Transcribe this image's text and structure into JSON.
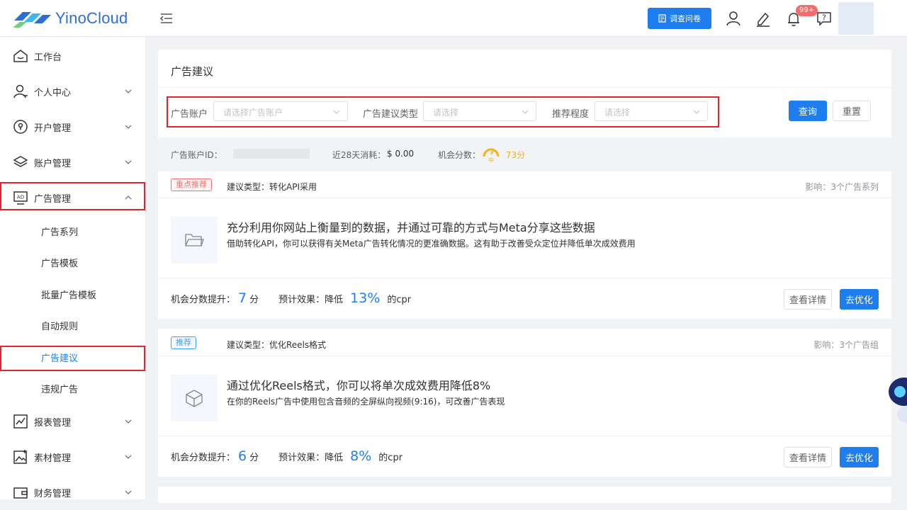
{
  "header": {
    "brand": "YinoCloud",
    "survey_label": "调查问卷",
    "notification_count": "99+"
  },
  "sidebar": {
    "items": [
      {
        "label": "工作台"
      },
      {
        "label": "个人中心"
      },
      {
        "label": "开户管理"
      },
      {
        "label": "账户管理"
      },
      {
        "label": "广告管理"
      },
      {
        "label": "报表管理"
      },
      {
        "label": "素材管理"
      },
      {
        "label": "财务管理"
      }
    ],
    "sub_items": [
      {
        "label": "广告系列"
      },
      {
        "label": "广告模板"
      },
      {
        "label": "批量广告模板"
      },
      {
        "label": "自动规则"
      },
      {
        "label": "广告建议"
      },
      {
        "label": "违规广告"
      }
    ]
  },
  "page": {
    "title": "广告建议",
    "filters": {
      "account_label": "广告账户",
      "account_placeholder": "请选择广告账户",
      "type_label": "广告建议类型",
      "type_placeholder": "请选择",
      "level_label": "推荐程度",
      "level_placeholder": "请选择",
      "query_label": "查询",
      "reset_label": "重置"
    },
    "account_bar": {
      "id_label": "广告账户ID：",
      "spend_label": "近28天消耗：",
      "spend_value": "$ 0.00",
      "score_label": "机会分数：",
      "score_value": "73分",
      "score_level": "中"
    },
    "suggestions": [
      {
        "tag": "重点推荐",
        "type": "建议类型：转化API采用",
        "impact": "影响：3个广告系列",
        "headline": "充分利用你网站上衡量到的数据，并通过可靠的方式与Meta分享这些数据",
        "desc": "借助转化API，你可以获得有关Meta广告转化情况的更准确数据。这有助于改善受众定位并降低单次成效费用",
        "score_label": "机会分数提升：",
        "score_num": "7",
        "score_unit": "分",
        "effect_label": "预计效果：降低",
        "effect_num": "13%",
        "effect_unit": "的cpr",
        "detail_label": "查看详情",
        "optimize_label": "去优化"
      },
      {
        "tag": "推荐",
        "type": "建议类型：优化Reels格式",
        "impact": "影响：3个广告组",
        "headline": "通过优化Reels格式，你可以将单次成效费用降低8%",
        "desc": "在你的Reels广告中使用包含音频的全屏纵向视频(9:16)，可改善广告表现",
        "score_label": "机会分数提升：",
        "score_num": "6",
        "score_unit": "分",
        "effect_label": "预计效果：降低",
        "effect_num": "8%",
        "effect_unit": "的cpr",
        "detail_label": "查看详情",
        "optimize_label": "去优化"
      }
    ]
  }
}
